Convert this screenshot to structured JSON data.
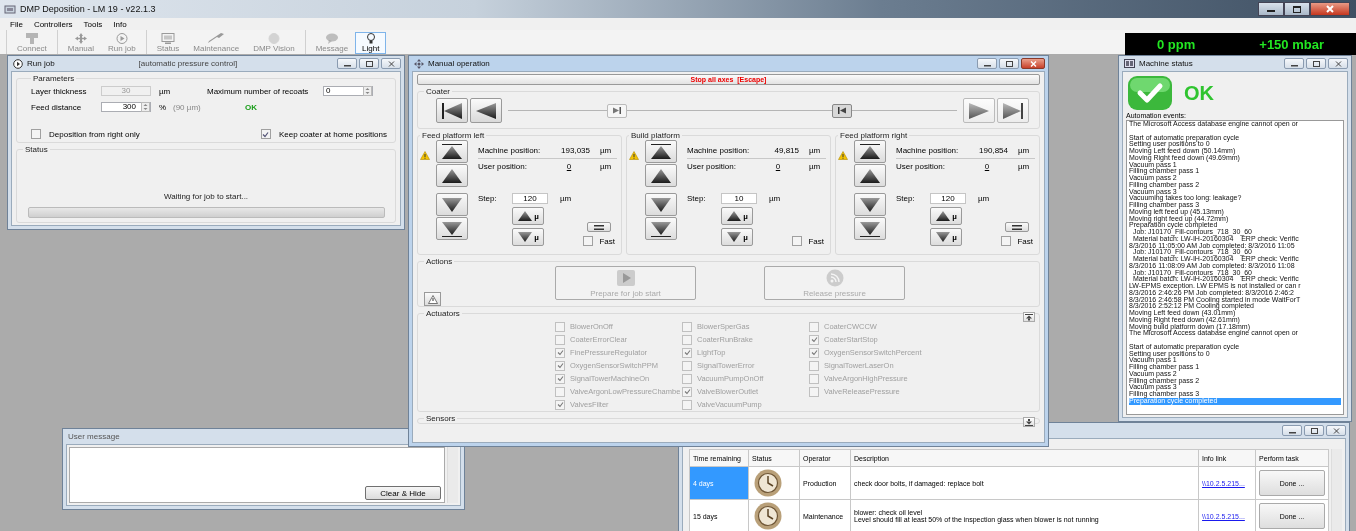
{
  "app": {
    "title": "DMP Deposition - LM 19 - v22.1.3"
  },
  "menu": [
    "File",
    "Controllers",
    "Tools",
    "Info"
  ],
  "toolbar": [
    [
      {
        "label": "Connect",
        "selected": false
      }
    ],
    [
      {
        "label": "Manual",
        "selected": false
      },
      {
        "label": "Run job",
        "selected": false
      }
    ],
    [
      {
        "label": "Status",
        "selected": false
      },
      {
        "label": "Maintenance",
        "selected": false
      },
      {
        "label": "DMP Vision",
        "selected": false
      }
    ],
    [
      {
        "label": "Message",
        "selected": false
      },
      {
        "label": "Light",
        "selected": true
      }
    ]
  ],
  "readouts": [
    "0 ppm",
    "+150 mbar"
  ],
  "run_job": {
    "title": "Run job",
    "mode": "[automatic pressure control]",
    "parameters": {
      "title": "Parameters",
      "layer_label": "Layer thickness",
      "layer": "30",
      "layer_unit": "µm",
      "feed_label": "Feed distance",
      "feed": "300",
      "feed_unit": "%",
      "feed_hint": "(90 µm)",
      "recoats_label": "Maximum number of recoats",
      "recoats": "0",
      "check_text": "OK"
    },
    "options": [
      {
        "label": "Deposition from right only",
        "checked": false
      },
      {
        "label": "Keep coater at home positions",
        "checked": true
      }
    ],
    "status": {
      "title": "Status",
      "message": "Waiting for job to start...",
      "level": 0
    }
  },
  "manual": {
    "title": "Manual operation",
    "stop": "Stop all axes  [Escape]",
    "coater": {
      "title": "Coater"
    },
    "platforms": [
      {
        "title": "Feed platform left",
        "warning": true,
        "machine_label": "Machine position:",
        "machine": "193,035",
        "machine_unit": "µm",
        "user_label": "User position:",
        "user": "0",
        "user_unit": "µm",
        "step_label": "Step:",
        "step": "120",
        "step_unit": "µm",
        "reset_button": true,
        "step_marks": [
          "µ",
          "µ"
        ],
        "fast_label": "Fast",
        "fast": false
      },
      {
        "title": "Build platform",
        "warning": true,
        "machine_label": "Machine position:",
        "machine": "49,815",
        "machine_unit": "µm",
        "user_label": "User position:",
        "user": "0",
        "user_unit": "µm",
        "step_label": "Step:",
        "step": "10",
        "step_unit": "µm",
        "reset_button": false,
        "step_marks": [
          "µ",
          "µ"
        ],
        "fast_label": "Fast",
        "fast": false
      },
      {
        "title": "Feed platform right",
        "warning": true,
        "machine_label": "Machine position:",
        "machine": "190,854",
        "machine_unit": "µm",
        "user_label": "User position:",
        "user": "0",
        "user_unit": "µm",
        "step_label": "Step:",
        "step": "120",
        "step_unit": "µm",
        "reset_button": true,
        "step_marks": [
          "µ",
          "µ"
        ],
        "fast_label": "Fast",
        "fast": false
      }
    ],
    "actions": {
      "title": "Actions",
      "buttons": [
        {
          "label": "Prepare for job start",
          "disabled": true
        },
        {
          "label": "Release pressure",
          "disabled": true
        }
      ]
    },
    "actuators": {
      "title": "Actuators",
      "disabled": true,
      "items": [
        {
          "label": "BlowerOnOff",
          "checked": false
        },
        {
          "label": "BlowerSperGas",
          "checked": false
        },
        {
          "label": "CoaterCWCCW",
          "checked": false
        },
        {
          "label": "CoaterErrorClear",
          "checked": false
        },
        {
          "label": "CoaterRunBrake",
          "checked": false
        },
        {
          "label": "CoaterStartStop",
          "checked": true
        },
        {
          "label": "FinePressureRegulator",
          "checked": true
        },
        {
          "label": "LightTop",
          "checked": true
        },
        {
          "label": "OxygenSensorSwitchPercent",
          "checked": true
        },
        {
          "label": "OxygenSensorSwitchPPM",
          "checked": true
        },
        {
          "label": "SignalTowerError",
          "checked": false
        },
        {
          "label": "SignalTowerLaserOn",
          "checked": false
        },
        {
          "label": "SignalTowerMachineOn",
          "checked": true
        },
        {
          "label": "VacuumPumpOnOff",
          "checked": false
        },
        {
          "label": "ValveArgonHighPressure",
          "checked": false
        },
        {
          "label": "ValveArgonLowPressureChambe",
          "checked": false
        },
        {
          "label": "ValveBlowerOutlet",
          "checked": true
        },
        {
          "label": "ValveReleasePressure",
          "checked": false
        },
        {
          "label": "ValvesFilter",
          "checked": true
        },
        {
          "label": "ValveVacuumPump",
          "checked": false
        }
      ]
    },
    "sensors": {
      "title": "Sensors"
    }
  },
  "machine_status": {
    "title": "Machine status",
    "state": "OK",
    "events_label": "Automation events:",
    "log": [
      [
        {
          "text": "The Microsoft Access database engine cannot open or",
          "selected": false
        }
      ],
      [
        {
          "text": "Start of automatic preparation cycle",
          "selected": false
        },
        {
          "text": "Setting user positions to 0",
          "selected": false
        },
        {
          "text": "Moving Left feed down (50.14mm)",
          "selected": false
        },
        {
          "text": "Moving Right feed down (49.69mm)",
          "selected": false
        },
        {
          "text": "Vacuum pass 1",
          "selected": false
        },
        {
          "text": "Filling chamber pass 1",
          "selected": false
        },
        {
          "text": "Vacuum pass 2",
          "selected": false
        },
        {
          "text": "Filling chamber pass 2",
          "selected": false
        },
        {
          "text": "Vacuum pass 3",
          "selected": false
        },
        {
          "text": "Vacuuming takes too long: leakage?",
          "selected": false
        },
        {
          "text": "Filling chamber pass 3",
          "selected": false
        },
        {
          "text": "Moving left feed up (45.13mm)",
          "selected": false
        },
        {
          "text": "Moving right feed up (44.72mm)",
          "selected": false
        },
        {
          "text": "Preparation cycle completed",
          "selected": false
        },
        {
          "text": "  Job: J10170_Fill-contours_718_30_60",
          "selected": false
        },
        {
          "text": "  Material batch: LW-IH-20160304    ERP check: Verific",
          "selected": false
        },
        {
          "text": "8/3/2016 11:05:00 AM Job completed: 8/3/2016 11:05",
          "selected": false
        },
        {
          "text": "  Job: J10170_Fill-contours_718_30_60",
          "selected": false
        },
        {
          "text": "  Material batch: LW-IH-20160304    ERP check: Verific",
          "selected": false
        },
        {
          "text": "8/3/2016 11:08:09 AM Job completed: 8/3/2016 11:08",
          "selected": false
        },
        {
          "text": "  Job: J10170_Fill-contours_718_30_60",
          "selected": false
        },
        {
          "text": "  Material batch: LW-IH-20160304    ERP check: Verific",
          "selected": false
        },
        {
          "text": "LW-EPMS exception. LW EPMS is not installed or can r",
          "selected": false
        },
        {
          "text": "8/3/2016 2:46:26 PM Job completed: 8/3/2016 2:46:2",
          "selected": false
        },
        {
          "text": "8/3/2016 2:46:58 PM Cooling started in mode WaitForT",
          "selected": false
        },
        {
          "text": "8/3/2016 2:52:12 PM Cooling completed",
          "selected": false
        },
        {
          "text": "Moving Left feed down (43.01mm)",
          "selected": false
        },
        {
          "text": "Moving Right feed down (42.61mm)",
          "selected": false
        },
        {
          "text": "Moving build platform down (17.18mm)",
          "selected": false
        },
        {
          "text": "The Microsoft Access database engine cannot open or",
          "selected": false
        }
      ],
      [
        {
          "text": "Start of automatic preparation cycle",
          "selected": false
        },
        {
          "text": "Setting user positions to 0",
          "selected": false
        },
        {
          "text": "Vacuum pass 1",
          "selected": false
        },
        {
          "text": "Filling chamber pass 1",
          "selected": false
        },
        {
          "text": "Vacuum pass 2",
          "selected": false
        },
        {
          "text": "Filling chamber pass 2",
          "selected": false
        },
        {
          "text": "Vacuum pass 3",
          "selected": false
        },
        {
          "text": "Filling chamber pass 3",
          "selected": false
        },
        {
          "text": "Preparation cycle completed",
          "selected": true
        }
      ]
    ]
  },
  "user_message": {
    "title": "User message",
    "button": "Clear & Hide"
  },
  "maintenance": {
    "columns": [
      "Time remaining",
      "Status",
      "Operator",
      "Description",
      "Info link",
      "Perform task"
    ],
    "rows": [
      {
        "time": "4 days",
        "selected": true,
        "operator": "Production",
        "description": [
          "check door bolts, if damaged: replace bolt"
        ],
        "link": "\\\\10.2.5.215...",
        "action": "Done ..."
      },
      {
        "time": "15 days",
        "selected": false,
        "operator": "Maintenance",
        "description": [
          "blower: check oil level",
          "Level should fill at least 50% of the inspection glass when blower is not running"
        ],
        "link": "\\\\10.2.5.215...",
        "action": "Done ..."
      }
    ]
  }
}
